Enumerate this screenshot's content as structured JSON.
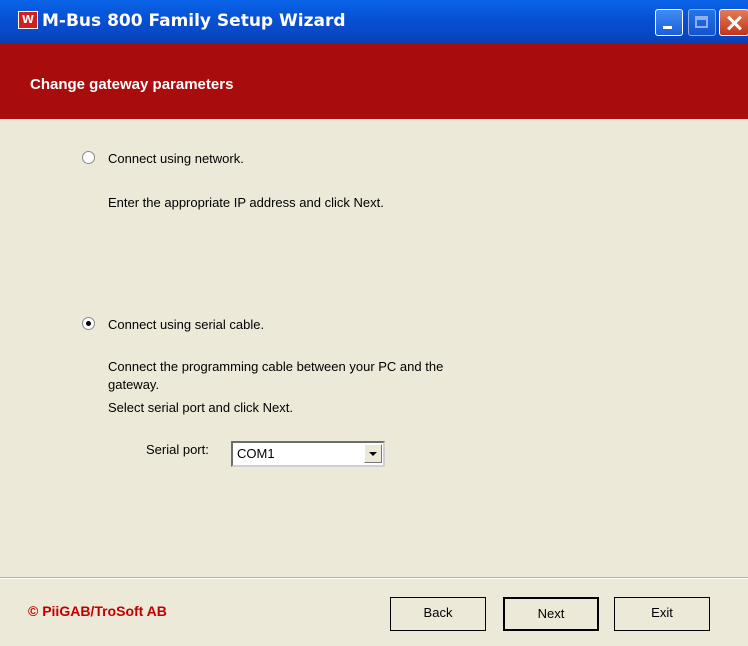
{
  "window": {
    "title": "M-Bus 800 Family Setup Wizard",
    "app_icon_letter": "W",
    "accent_header_color": "#a80c0c"
  },
  "header": {
    "title": "Change gateway parameters"
  },
  "options": {
    "network": {
      "label": "Connect using network.",
      "description": "Enter the appropriate IP address and click Next.",
      "selected": false
    },
    "serial": {
      "label": "Connect using serial cable.",
      "description_line1": "Connect the programming cable between your PC and the",
      "description_line2": "gateway.",
      "description_line3": "Select serial port and click Next.",
      "selected": true
    }
  },
  "serial_port": {
    "label": "Serial port:",
    "value": "COM1"
  },
  "footer": {
    "copyright": "© PiiGAB/TroSoft AB",
    "back_label": "Back",
    "next_label": "Next",
    "exit_label": "Exit"
  }
}
